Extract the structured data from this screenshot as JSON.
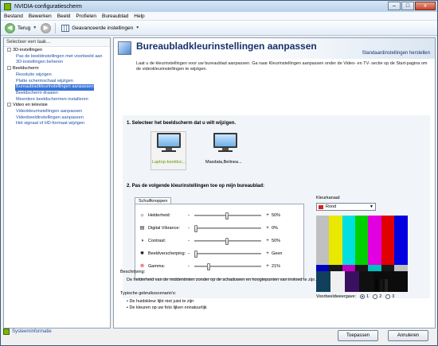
{
  "window": {
    "title": "NVIDIA-configuratiescherm",
    "controls": {
      "minimize": "–",
      "maximize": "□",
      "close": "x"
    }
  },
  "menu": [
    "Bestand",
    "Bewerken",
    "Beeld",
    "Profielen",
    "Bureaublad",
    "Help"
  ],
  "toolbar": {
    "back_label": "Terug",
    "advanced_label": "Geavanceerde instellingen"
  },
  "sidebar": {
    "header": "Selecteer een taak...",
    "categories": [
      {
        "label": "3D-instellingen",
        "items": [
          "Pas de beeldinstellingen met voorbeeld aan",
          "3D-instellingen beheren"
        ]
      },
      {
        "label": "Beeldscherm",
        "items": [
          "Resolutie wijzigen",
          "Platte schermschaal wijzigen",
          "Bureaubladkleurinstellingen aanpassen",
          "Beeldscherm draaien",
          "Meerdere beeldschermen installeren"
        ]
      },
      {
        "label": "Video en televisie",
        "items": [
          "Videokleurinstellingen aanpassen",
          "Videobeeldinstellingen aanpassen",
          "Het signaal of HD-formaat wijzigen"
        ]
      }
    ],
    "selected_item": "Bureaubladkleurinstellingen aanpassen",
    "system_info": "Systeeminformatie"
  },
  "main": {
    "title": "Bureaubladkleurinstellingen aanpassen",
    "restore_defaults": "Standaardinstellingen herstellen",
    "description": "Laat u de kleurinstellingen voor uw bureaublad aanpassen. Ga naar Kleurinstellingen aanpassen onder de Video- en TV- sectie op de Start-pagina om de videokleurinstellingen te wijzigen.",
    "step1": "1. Selecteer het beeldscherm dat u wilt wijzigen.",
    "monitors": [
      "Laptop-beeldsc...",
      "Maxdata,Belinea..."
    ],
    "step2": "2. Pas de volgende kleurinstellingen toe op mijn bureaublad:",
    "sliders_tab": "Schuifknoppen",
    "sliders": [
      {
        "icon": "brightness-icon",
        "label": "Helderheid:",
        "value": "50%",
        "level": 0.5
      },
      {
        "icon": "vibrance-icon",
        "label": "Digital Vibrance:",
        "value": "0%",
        "level": 0.0
      },
      {
        "icon": "contrast-icon",
        "label": "Contrast:",
        "value": "50%",
        "level": 0.5
      },
      {
        "icon": "sharpness-icon",
        "label": "Beeldverscherping:",
        "value": "Geen",
        "level": 0.0
      },
      {
        "icon": "gamma-icon",
        "label": "Gamma:",
        "value": "21%",
        "level": 0.21
      }
    ],
    "color_channel_label": "Kleurkanaal:",
    "color_channel_value": "Rood",
    "color_channel_swatch": "#d72020",
    "preview_label": "Voorbeeldweergave:",
    "preview_options": [
      "1",
      "2",
      "3"
    ],
    "description_label": "Beschrijving:",
    "description_text": "De helderheid van de middentinten zonder op de schaduwen en hoogtepunten van invloed te zijn.",
    "usage_label": "Typische gebruiksscenario's:",
    "usage_items": [
      "• De huidskleur lijkt niet juist te zijn",
      "• De kleuren op uw foto lijken onnatuurlijk"
    ]
  },
  "buttons": {
    "apply": "Toepassen",
    "cancel": "Annuleren"
  },
  "colors": {
    "accent": "#76b900",
    "selection": "#3874d8",
    "title_blue": "#15306b"
  }
}
